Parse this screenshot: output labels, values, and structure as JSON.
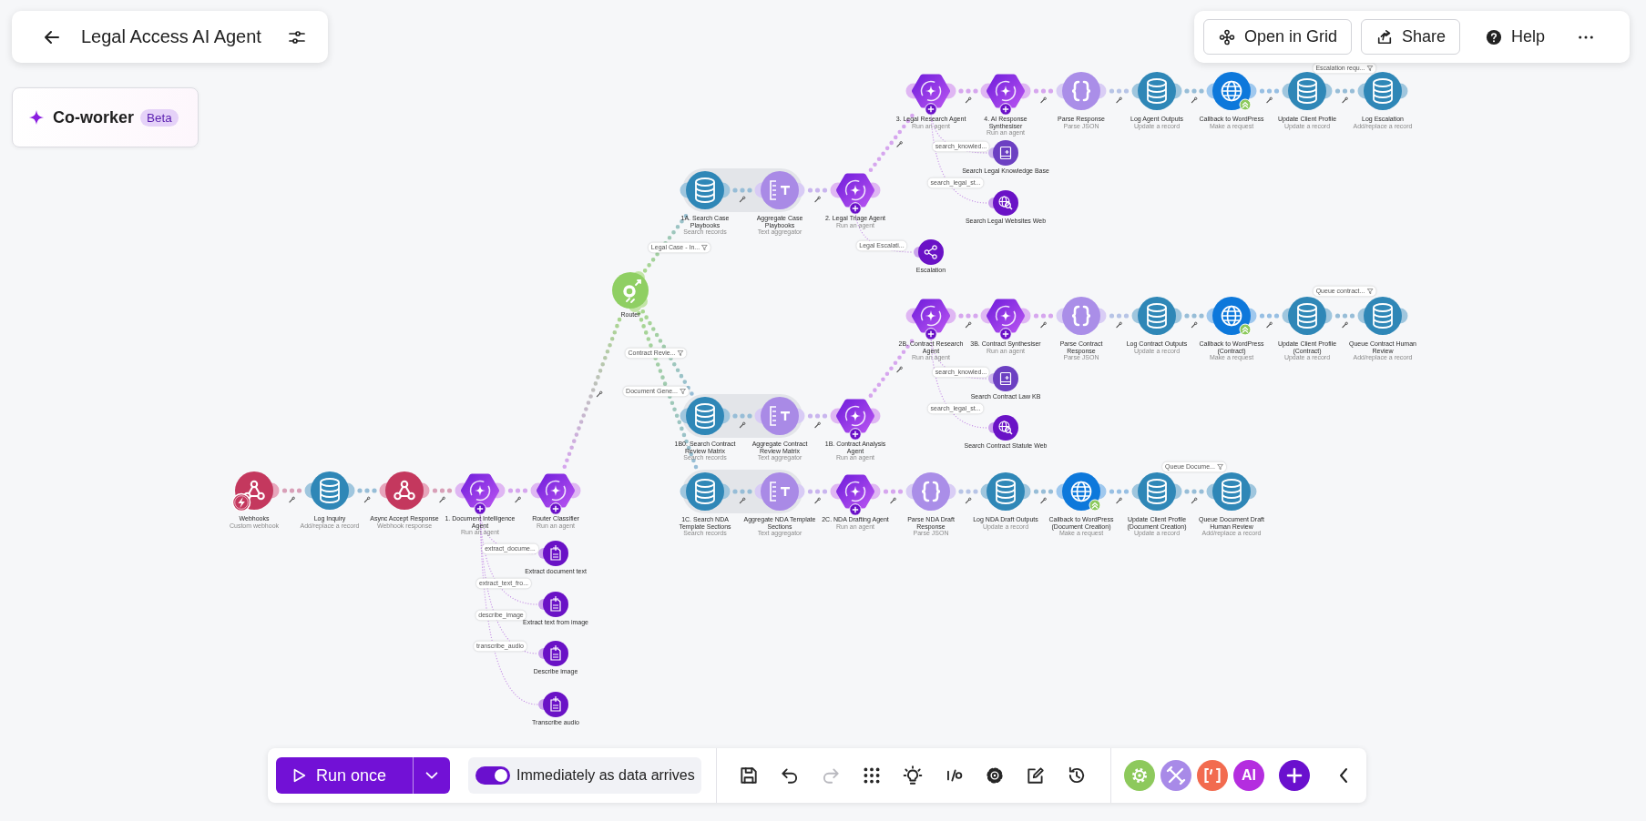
{
  "header": {
    "title": "Legal Access AI Agent"
  },
  "coworker": {
    "label": "Co-worker",
    "badge": "Beta"
  },
  "top_actions": [
    {
      "kind": "grid",
      "label": "Open in Grid"
    },
    {
      "kind": "share",
      "label": "Share"
    },
    {
      "kind": "help",
      "label": "Help"
    },
    {
      "kind": "more"
    }
  ],
  "canvas": {
    "modules": [
      {
        "name": "Webhooks",
        "subtitle": "Custom webhook",
        "kind": "webhook-trigger"
      },
      {
        "name": "Log Inquiry",
        "subtitle": "Add/replace a record",
        "kind": "datastore"
      },
      {
        "name": "Async Accept Response",
        "subtitle": "Webhook response",
        "kind": "webhook"
      },
      {
        "name": "1. Document Intelligence Agent",
        "subtitle": "Run an agent",
        "kind": "agent"
      },
      {
        "name": "Router Classifier",
        "subtitle": "Run an agent",
        "kind": "agent"
      },
      {
        "name": "Extract document text",
        "kind": "doc-tool",
        "link_label": "extract_docume..."
      },
      {
        "name": "Extract text from image",
        "kind": "doc-tool",
        "link_label": "extract_text_fro..."
      },
      {
        "name": "Describe image",
        "kind": "doc-tool",
        "link_label": "describe_image"
      },
      {
        "name": "Transcribe audio",
        "kind": "doc-tool",
        "link_label": "transcribe_audio"
      },
      {
        "name": "Router",
        "kind": "router"
      },
      {
        "name": "1A. Search Case Playbooks",
        "subtitle": "Search records",
        "kind": "datastore",
        "link_label": "Legal Case - In..."
      },
      {
        "name": "Aggregate Case Playbooks",
        "subtitle": "Text aggregator",
        "kind": "aggregator"
      },
      {
        "name": "2. Legal Triage Agent",
        "subtitle": "Run an agent",
        "kind": "agent"
      },
      {
        "name": "3. Legal Research Agent",
        "subtitle": "Run an agent",
        "kind": "agent"
      },
      {
        "name": "4. AI Response Synthesiser",
        "subtitle": "Run an agent",
        "kind": "agent"
      },
      {
        "name": "Parse Response",
        "subtitle": "Parse JSON",
        "kind": "json"
      },
      {
        "name": "Log Agent Outputs",
        "subtitle": "Update a record",
        "kind": "datastore"
      },
      {
        "name": "Callback to WordPress",
        "subtitle": "Make a request",
        "kind": "http"
      },
      {
        "name": "Update Client Profile",
        "subtitle": "Update a record",
        "kind": "datastore"
      },
      {
        "name": "Log Escalation",
        "subtitle": "Add/replace a record",
        "kind": "datastore",
        "link_label": "Escalation requ..."
      },
      {
        "name": "Search Legal Knowledge Base",
        "kind": "knowledge-tool",
        "link_label": "search_knowled..."
      },
      {
        "name": "Search Legal Websites Web",
        "kind": "web-tool",
        "link_label": "search_legal_st..."
      },
      {
        "name": "Escalation",
        "kind": "share-tool",
        "link_label": "Legal Escalati..."
      },
      {
        "name": "1B0. Search Contract Review Matrix",
        "subtitle": "Search records",
        "kind": "datastore",
        "link_label": "Contract Revie..."
      },
      {
        "name": "Aggregate Contract Review Matrix",
        "subtitle": "Text aggregator",
        "kind": "aggregator"
      },
      {
        "name": "1B. Contract Analysis Agent",
        "subtitle": "Run an agent",
        "kind": "agent"
      },
      {
        "name": "2B. Contract Research Agent",
        "subtitle": "Run an agent",
        "kind": "agent"
      },
      {
        "name": "3B. Contract Synthesiser",
        "subtitle": "Run an agent",
        "kind": "agent"
      },
      {
        "name": "Parse Contract Response",
        "subtitle": "Parse JSON",
        "kind": "json"
      },
      {
        "name": "Log Contract Outputs",
        "subtitle": "Update a record",
        "kind": "datastore"
      },
      {
        "name": "Callback to WordPress (Contract)",
        "subtitle": "Make a request",
        "kind": "http"
      },
      {
        "name": "Update Client Profile (Contract)",
        "subtitle": "Update a record",
        "kind": "datastore"
      },
      {
        "name": "Queue Contract Human Review",
        "subtitle": "Add/replace a record",
        "kind": "datastore",
        "link_label": "Queue contract..."
      },
      {
        "name": "Search Contract Law KB",
        "kind": "knowledge-tool",
        "link_label": "search_knowled..."
      },
      {
        "name": "Search Contract Statute Web",
        "kind": "web-tool",
        "link_label": "search_legal_st..."
      },
      {
        "name": "1C. Search NDA Template Sections",
        "subtitle": "Search records",
        "kind": "datastore",
        "link_label": "Document Gene..."
      },
      {
        "name": "Aggregate NDA Template Sections",
        "subtitle": "Text aggregator",
        "kind": "aggregator"
      },
      {
        "name": "2C. NDA Drafting Agent",
        "subtitle": "Run an agent",
        "kind": "agent"
      },
      {
        "name": "Parse NDA Draft Response",
        "subtitle": "Parse JSON",
        "kind": "json"
      },
      {
        "name": "Log NDA Draft Outputs",
        "subtitle": "Update a record",
        "kind": "datastore"
      },
      {
        "name": "Callback to WordPress (Document Creation)",
        "subtitle": "Make a request",
        "kind": "http"
      },
      {
        "name": "Update Client Profile (Document Creation)",
        "subtitle": "Update a record",
        "kind": "datastore"
      },
      {
        "name": "Queue Document Draft Human Review",
        "subtitle": "Add/replace a record",
        "kind": "datastore",
        "link_label": "Queue Docume..."
      }
    ]
  },
  "toolbar": {
    "run_button": {
      "label": "Run once"
    },
    "schedule": {
      "label": "Immediately as data arrives",
      "on": true
    },
    "tools": [
      {
        "kind": "save",
        "disabled": false
      },
      {
        "kind": "undo",
        "disabled": false
      },
      {
        "kind": "redo",
        "disabled": true
      },
      {
        "kind": "align",
        "disabled": false
      },
      {
        "kind": "bulb",
        "disabled": false
      },
      {
        "kind": "io",
        "disabled": false
      },
      {
        "kind": "settings",
        "disabled": false
      },
      {
        "kind": "notes",
        "disabled": false
      },
      {
        "kind": "history",
        "disabled": false
      }
    ],
    "apps": [
      {
        "kind": "gear"
      },
      {
        "kind": "tools"
      },
      {
        "kind": "bracket"
      },
      {
        "kind": "ai",
        "label": "AI"
      },
      {
        "kind": "add"
      },
      {
        "kind": "collapse"
      }
    ]
  }
}
